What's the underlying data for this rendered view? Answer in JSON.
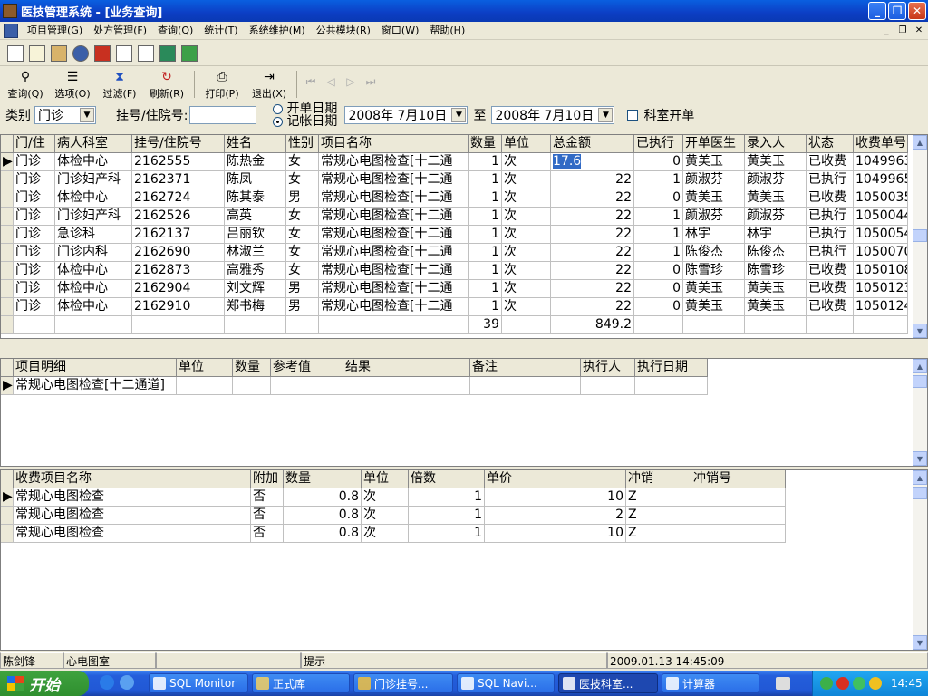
{
  "title": "医技管理系统 - [业务查询]",
  "menu": [
    "项目管理(G)",
    "处方管理(F)",
    "查询(Q)",
    "统计(T)",
    "系统维护(M)",
    "公共模块(R)",
    "窗口(W)",
    "帮助(H)"
  ],
  "toolbar": {
    "query": "查询(Q)",
    "options": "选项(O)",
    "filter": "过滤(F)",
    "refresh": "刷新(R)",
    "print": "打印(P)",
    "exit": "退出(X)"
  },
  "filter": {
    "category_label": "类别",
    "category_value": "门诊",
    "reg_label": "挂号/住院号:",
    "reg_value": "",
    "radio_open": "开单日期",
    "radio_post": "记帐日期",
    "date_from": "2008年 7月10日",
    "to_label": "至",
    "date_to": "2008年 7月10日",
    "dept_open_label": "科室开单"
  },
  "main_grid": {
    "columns": [
      "门/住",
      "病人科室",
      "挂号/住院号",
      "姓名",
      "性别",
      "项目名称",
      "数量",
      "单位",
      "总金额",
      "已执行",
      "开单医生",
      "录入人",
      "状态",
      "收费单号"
    ],
    "rows": [
      [
        "门诊",
        "体检中心",
        "2162555",
        "陈热金",
        "女",
        "常规心电图检查[十二通",
        "1",
        "次",
        "17.6",
        "0",
        "黄美玉",
        "黄美玉",
        "已收费",
        "10499636"
      ],
      [
        "门诊",
        "门诊妇产科",
        "2162371",
        "陈凤",
        "女",
        "常规心电图检查[十二通",
        "1",
        "次",
        "22",
        "1",
        "颜淑芬",
        "颜淑芬",
        "已执行",
        "10499650"
      ],
      [
        "门诊",
        "体检中心",
        "2162724",
        "陈其泰",
        "男",
        "常规心电图检查[十二通",
        "1",
        "次",
        "22",
        "0",
        "黄美玉",
        "黄美玉",
        "已收费",
        "10500359"
      ],
      [
        "门诊",
        "门诊妇产科",
        "2162526",
        "高英",
        "女",
        "常规心电图检查[十二通",
        "1",
        "次",
        "22",
        "1",
        "颜淑芬",
        "颜淑芬",
        "已执行",
        "10500446"
      ],
      [
        "门诊",
        "急诊科",
        "2162137",
        "吕丽钦",
        "女",
        "常规心电图检查[十二通",
        "1",
        "次",
        "22",
        "1",
        "林宇",
        "林宇",
        "已执行",
        "10500549"
      ],
      [
        "门诊",
        "门诊内科",
        "2162690",
        "林淑兰",
        "女",
        "常规心电图检查[十二通",
        "1",
        "次",
        "22",
        "1",
        "陈俊杰",
        "陈俊杰",
        "已执行",
        "10500706"
      ],
      [
        "门诊",
        "体检中心",
        "2162873",
        "高雅秀",
        "女",
        "常规心电图检查[十二通",
        "1",
        "次",
        "22",
        "0",
        "陈雪珍",
        "陈雪珍",
        "已收费",
        "10501086"
      ],
      [
        "门诊",
        "体检中心",
        "2162904",
        "刘文辉",
        "男",
        "常规心电图检查[十二通",
        "1",
        "次",
        "22",
        "0",
        "黄美玉",
        "黄美玉",
        "已收费",
        "10501237"
      ],
      [
        "门诊",
        "体检中心",
        "2162910",
        "郑书梅",
        "男",
        "常规心电图检查[十二通",
        "1",
        "次",
        "22",
        "0",
        "黄美玉",
        "黄美玉",
        "已收费",
        "10501247"
      ]
    ],
    "totals": {
      "quantity": "39",
      "amount": "849.2"
    }
  },
  "detail_grid": {
    "columns": [
      "项目明细",
      "单位",
      "数量",
      "参考值",
      "结果",
      "备注",
      "执行人",
      "执行日期"
    ],
    "rows": [
      [
        "常规心电图检查[十二通道]",
        "",
        "",
        "",
        "",
        "",
        "",
        ""
      ]
    ]
  },
  "fee_grid": {
    "columns": [
      "收费项目名称",
      "附加",
      "数量",
      "单位",
      "倍数",
      "单价",
      "冲销",
      "冲销号"
    ],
    "rows": [
      [
        "常规心电图检查",
        "否",
        "0.8",
        "次",
        "1",
        "10",
        "Z",
        ""
      ],
      [
        "常规心电图检查",
        "否",
        "0.8",
        "次",
        "1",
        "2",
        "Z",
        ""
      ],
      [
        "常规心电图检查",
        "否",
        "0.8",
        "次",
        "1",
        "10",
        "Z",
        ""
      ]
    ]
  },
  "status": {
    "user": "陈剑锋",
    "dept": "心电图室",
    "hint": "提示",
    "datetime": "2009.01.13 14:45:09"
  },
  "taskbar": {
    "start": "开始",
    "tasks": [
      "SQL Monitor",
      "正式库",
      "门诊挂号...",
      "SQL Navi...",
      "医技科室...",
      "计算器"
    ],
    "clock": "14:45"
  }
}
